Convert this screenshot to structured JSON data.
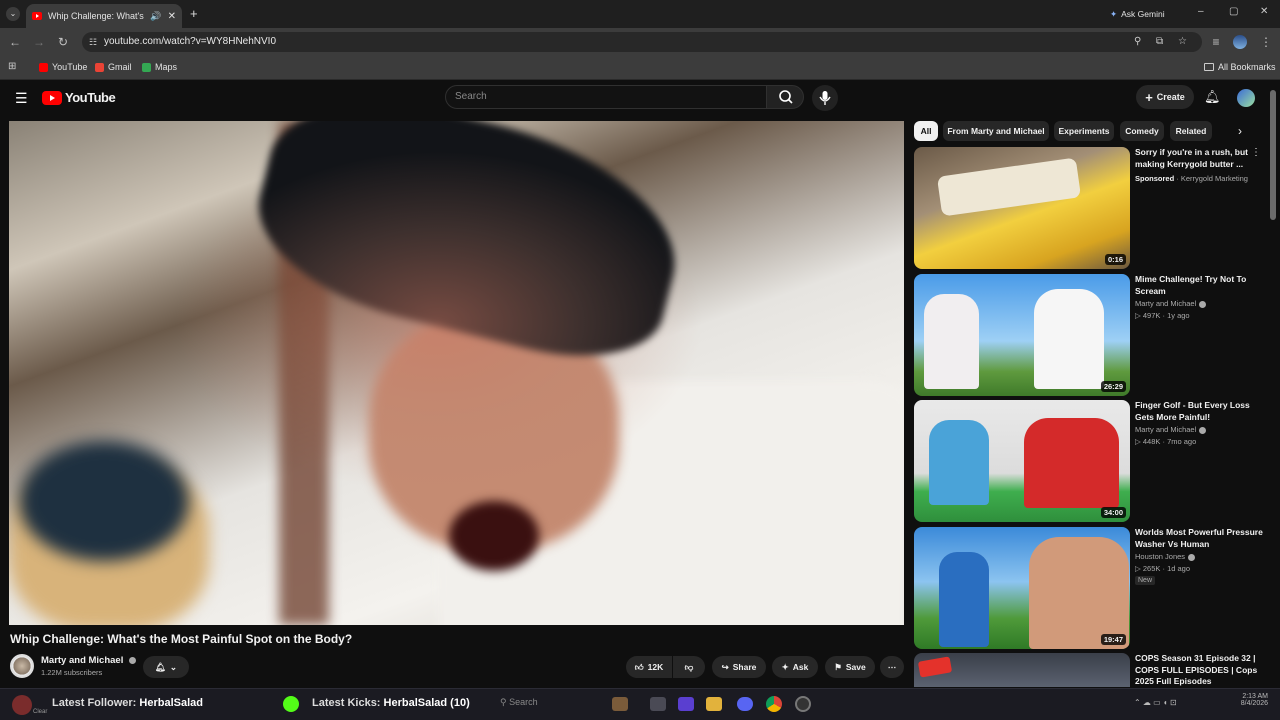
{
  "browser": {
    "tab_title": "Whip Challenge: What's the",
    "url": "youtube.com/watch?v=WY8HNehNVI0",
    "ask_gemini": "Ask Gemini",
    "bookmarks": [
      {
        "label": "YouTube",
        "color": "#ff0000"
      },
      {
        "label": "Gmail",
        "color": "#ea4335"
      },
      {
        "label": "Maps",
        "color": "#34a853"
      }
    ],
    "all_bookmarks": "All Bookmarks"
  },
  "youtube": {
    "logo_text": "YouTube",
    "search_placeholder": "Search",
    "create_label": "Create"
  },
  "video": {
    "title": "Whip Challenge: What's the Most Painful Spot on the Body?",
    "channel": "Marty and Michael",
    "subscribers": "1.22M subscribers",
    "likes": "12K",
    "share": "Share",
    "ask": "Ask",
    "save": "Save"
  },
  "chips": [
    "All",
    "From Marty and Michael",
    "Experiments",
    "Comedy",
    "Related"
  ],
  "recommendations": [
    {
      "title": "Sorry if you're in a rush, but making Kerrygold butter ...",
      "sponsored": "Sponsored",
      "advertiser": "Kerrygold Marketing",
      "duration": "0:16"
    },
    {
      "title": "Mime Challenge! Try Not To Scream",
      "channel": "Marty and Michael",
      "views": "497K",
      "age": "1y ago",
      "duration": "26:29"
    },
    {
      "title": "Finger Golf - But Every Loss Gets More Painful!",
      "channel": "Marty and Michael",
      "views": "448K",
      "age": "7mo ago",
      "duration": "34:00"
    },
    {
      "title": "Worlds Most Powerful Pressure Washer Vs Human",
      "channel": "Houston Jones",
      "views": "265K",
      "age": "1d ago",
      "badge": "New",
      "duration": "19:47"
    },
    {
      "title": "COPS Season 31 Episode 32 | COPS FULL EPISODES | Cops 2025 Full Episodes"
    }
  ],
  "taskbar": {
    "follower_label": "Latest Follower:",
    "follower_name": "HerbalSalad",
    "kicks_label": "Latest Kicks:",
    "kicks_value": "HerbalSalad (10)",
    "search": "Search",
    "time": "2:13 AM",
    "date": "8/4/2026",
    "clear": "Clear"
  }
}
